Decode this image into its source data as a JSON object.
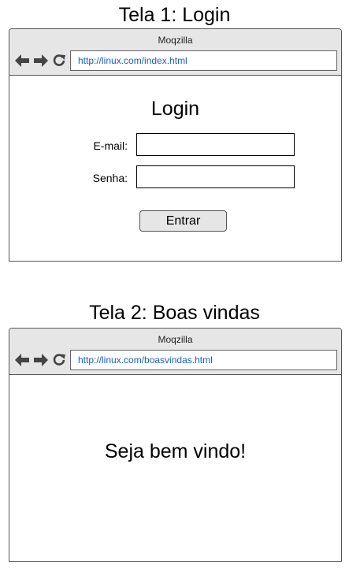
{
  "screens": [
    {
      "title": "Tela 1: Login",
      "browser": {
        "window_title": "Moqzilla",
        "url": "http://linux.com/index.html"
      },
      "login_form": {
        "heading": "Login",
        "email_label": "E-mail:",
        "email_value": "",
        "password_label": "Senha:",
        "password_value": "",
        "submit_label": "Entrar"
      }
    },
    {
      "title": "Tela 2: Boas vindas",
      "browser": {
        "window_title": "Moqzilla",
        "url": "http://linux.com/boasvindas.html"
      },
      "welcome_message": "Seja bem vindo!"
    }
  ],
  "icons": {
    "back": "arrow-left-icon",
    "forward": "arrow-right-icon",
    "reload": "reload-icon"
  },
  "colors": {
    "chrome_background": "#e6e6e6",
    "url_text": "#1a5fc4",
    "button_background": "#e6e6e6",
    "border": "#555555"
  }
}
